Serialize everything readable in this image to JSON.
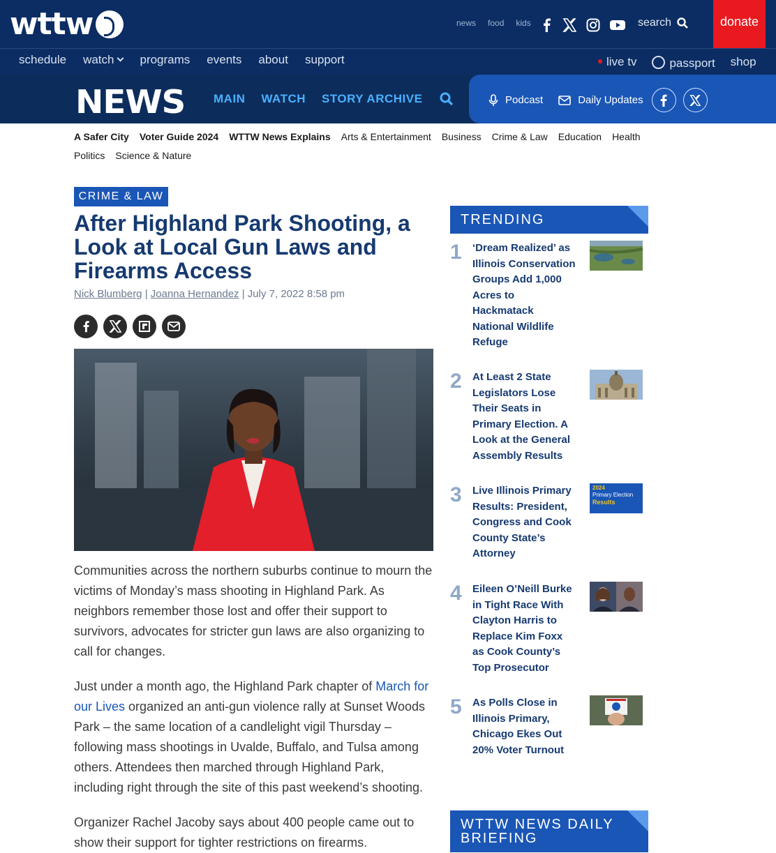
{
  "header": {
    "logo": "wttw",
    "top_links": [
      "news",
      "food",
      "kids"
    ],
    "social": [
      "facebook-icon",
      "x-icon",
      "instagram-icon",
      "youtube-icon"
    ],
    "search_label": "search",
    "donate_label": "donate"
  },
  "nav": {
    "left": [
      "schedule",
      "watch",
      "programs",
      "events",
      "about",
      "support"
    ],
    "live_tv": "live tv",
    "passport": "passport",
    "shop": "shop"
  },
  "newsbar": {
    "logo": "NEWS",
    "links": [
      "MAIN",
      "WATCH",
      "STORY ARCHIVE"
    ],
    "podcast": "Podcast",
    "daily_updates": "Daily Updates"
  },
  "categories": [
    {
      "label": "A Safer City",
      "bold": true
    },
    {
      "label": "Voter Guide 2024",
      "bold": true
    },
    {
      "label": "WTTW News Explains",
      "bold": true
    },
    {
      "label": "Arts & Entertainment",
      "bold": false
    },
    {
      "label": "Business",
      "bold": false
    },
    {
      "label": "Crime & Law",
      "bold": false
    },
    {
      "label": "Education",
      "bold": false
    },
    {
      "label": "Health",
      "bold": false
    },
    {
      "label": "Politics",
      "bold": false
    },
    {
      "label": "Science & Nature",
      "bold": false
    }
  ],
  "article": {
    "tag": "CRIME & LAW",
    "title": "After Highland Park Shooting, a Look at Local Gun Laws and Firearms Access",
    "author1": "Nick Blumberg",
    "author2": "Joanna Hernandez",
    "date": "July 7, 2022 8:58 pm",
    "p1": "Communities across the northern suburbs continue to mourn the victims of Monday’s mass shooting in Highland Park. As neighbors remember those lost and offer their support to survivors, advocates for stricter gun laws are also organizing to call for changes.",
    "p2_before": "Just under a month ago, the Highland Park chapter of ",
    "p2_link": "March for our Lives",
    "p2_after": " organized an anti-gun violence rally at Sunset Woods Park – the same location of a candlelight vigil Thursday – following mass shootings in Uvalde, Buffalo, and Tulsa among others. Attendees then marched through Highland Park, including right through the site of this past weekend’s shooting.",
    "p3": "Organizer Rachel Jacoby says about 400 people came out to show their support for tighter restrictions on firearms."
  },
  "trending": {
    "heading": "TRENDING",
    "items": [
      {
        "num": "1",
        "title": "‘Dream Realized’ as Illinois Conservation Groups Add 1,000 Acres to Hackmatack National Wildlife Refuge"
      },
      {
        "num": "2",
        "title": "At Least 2 State Legislators Lose Their Seats in Primary Election. A Look at the General Assembly Results"
      },
      {
        "num": "3",
        "title": "Live Illinois Primary Results: President, Congress and Cook County State’s Attorney"
      },
      {
        "num": "4",
        "title": "Eileen O’Neill Burke in Tight Race With Clayton Harris to Replace Kim Foxx as Cook County’s Top Prosecutor"
      },
      {
        "num": "5",
        "title": "As Polls Close in Illinois Primary, Chicago Ekes Out 20% Voter Turnout"
      }
    ],
    "thumb3_line1": "2024",
    "thumb3_line2": "Primary Election",
    "thumb3_line3": "Results"
  },
  "briefing": {
    "heading": "WTTW NEWS DAILY BRIEFING"
  }
}
